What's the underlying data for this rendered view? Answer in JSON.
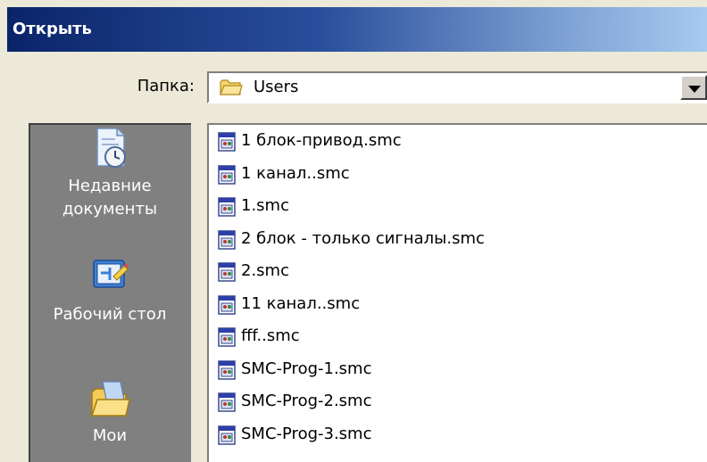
{
  "dialog": {
    "title": "Открыть"
  },
  "folder": {
    "label": "Папка:",
    "value": "Users"
  },
  "places": [
    {
      "label1": "Недавние",
      "label2": "документы",
      "icon": "recent-documents-icon"
    },
    {
      "label1": "Рабочий стол",
      "label2": "",
      "icon": "desktop-icon"
    },
    {
      "label1": "Мои",
      "label2": "",
      "icon": "my-documents-icon"
    }
  ],
  "files": [
    "1 блок-привод.smc",
    "1 канал..smc",
    "1.smc",
    "2 блок - только сигналы.smc",
    "2.smc",
    "11 канал..smc",
    "fff..smc",
    "SMC-Prog-1.smc",
    "SMC-Prog-2.smc",
    "SMC-Prog-3.smc"
  ]
}
